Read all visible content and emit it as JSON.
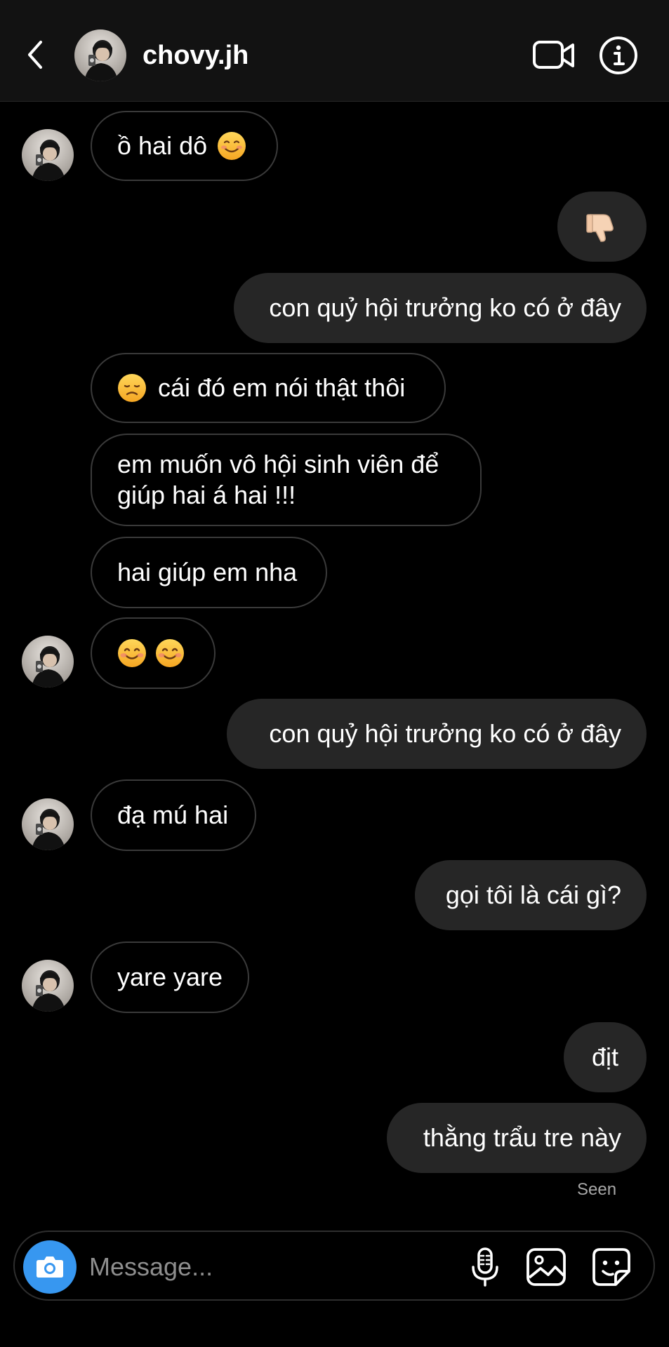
{
  "header": {
    "username": "chovy.jh"
  },
  "messages": [
    {
      "side": "received",
      "text": "ồ hai dô",
      "emoji": "smiling-relaxed"
    },
    {
      "side": "sent",
      "emoji": "thumbs-down"
    },
    {
      "side": "sent",
      "text": "con quỷ hội trưởng ko có ở đây"
    },
    {
      "side": "received",
      "emoji": "disappointed",
      "text": "cái đó em nói thật thôi"
    },
    {
      "side": "received",
      "text": "em muốn vô hội sinh viên để giúp hai á hai !!!"
    },
    {
      "side": "received",
      "text": "hai giúp em nha"
    },
    {
      "side": "received",
      "emoji": "smiling-blush-x2"
    },
    {
      "side": "sent",
      "text": "con quỷ hội trưởng ko có ở đây"
    },
    {
      "side": "received",
      "text": "đạ mú hai"
    },
    {
      "side": "sent",
      "text": "gọi tôi là cái gì?"
    },
    {
      "side": "received",
      "text": "yare yare"
    },
    {
      "side": "sent",
      "text": "địt"
    },
    {
      "side": "sent",
      "text": "thằng trẩu tre này"
    }
  ],
  "status": {
    "seen": "Seen"
  },
  "composer": {
    "placeholder": "Message..."
  },
  "colors": {
    "background": "#000000",
    "header_bg": "#121212",
    "sent_bubble": "#262626",
    "received_border": "#3a3a3a",
    "camera_button": "#3797f0",
    "muted_text": "#a8a8a8"
  }
}
